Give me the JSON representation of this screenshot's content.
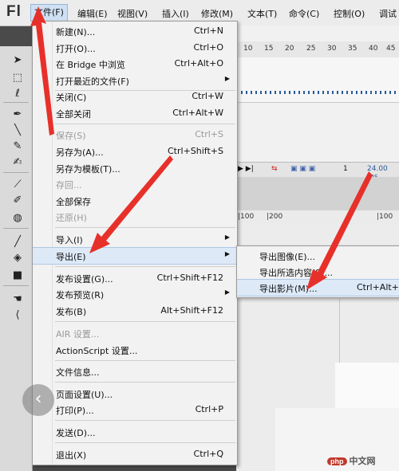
{
  "app": {
    "logo": "Fl"
  },
  "menubar": {
    "items": [
      "文件(F)",
      "编辑(E)",
      "视图(V)",
      "插入(I)",
      "修改(M)",
      "文本(T)",
      "命令(C)",
      "控制(O)",
      "调试"
    ],
    "active_index": 0
  },
  "file_menu": {
    "items": [
      {
        "label": "新建(N)...",
        "shortcut": "Ctrl+N",
        "enabled": true
      },
      {
        "label": "打开(O)...",
        "shortcut": "Ctrl+O",
        "enabled": true
      },
      {
        "label": "在 Bridge 中浏览",
        "shortcut": "Ctrl+Alt+O",
        "enabled": true
      },
      {
        "label": "打开最近的文件(F)",
        "shortcut": "",
        "enabled": true,
        "submenu": true
      },
      {
        "label": "关闭(C)",
        "shortcut": "Ctrl+W",
        "enabled": true
      },
      {
        "label": "全部关闭",
        "shortcut": "Ctrl+Alt+W",
        "enabled": true
      },
      {
        "label": "保存(S)",
        "shortcut": "Ctrl+S",
        "enabled": false
      },
      {
        "label": "另存为(A)...",
        "shortcut": "Ctrl+Shift+S",
        "enabled": true
      },
      {
        "label": "另存为模板(T)...",
        "shortcut": "",
        "enabled": true
      },
      {
        "label": "存回...",
        "shortcut": "",
        "enabled": false
      },
      {
        "label": "全部保存",
        "shortcut": "",
        "enabled": true
      },
      {
        "label": "还原(H)",
        "shortcut": "",
        "enabled": false
      },
      {
        "label": "导入(I)",
        "shortcut": "",
        "enabled": true,
        "submenu": true
      },
      {
        "label": "导出(E)",
        "shortcut": "",
        "enabled": true,
        "submenu": true,
        "highlight": true
      },
      {
        "label": "发布设置(G)...",
        "shortcut": "Ctrl+Shift+F12",
        "enabled": true
      },
      {
        "label": "发布预览(R)",
        "shortcut": "",
        "enabled": true,
        "submenu": true
      },
      {
        "label": "发布(B)",
        "shortcut": "Alt+Shift+F12",
        "enabled": true
      },
      {
        "label": "AIR 设置...",
        "shortcut": "",
        "enabled": false
      },
      {
        "label": "ActionScript 设置...",
        "shortcut": "",
        "enabled": true
      },
      {
        "label": "文件信息...",
        "shortcut": "",
        "enabled": true
      },
      {
        "label": "页面设置(U)...",
        "shortcut": "",
        "enabled": true
      },
      {
        "label": "打印(P)...",
        "shortcut": "Ctrl+P",
        "enabled": true
      },
      {
        "label": "发送(D)...",
        "shortcut": "",
        "enabled": true
      },
      {
        "label": "退出(X)",
        "shortcut": "Ctrl+Q",
        "enabled": true
      }
    ]
  },
  "export_submenu": {
    "items": [
      {
        "label": "导出图像(E)...",
        "shortcut": ""
      },
      {
        "label": "导出所选内容(S)...",
        "shortcut": ""
      },
      {
        "label": "导出影片(M)...",
        "shortcut": "Ctrl+Alt+S",
        "highlight": true
      }
    ]
  },
  "ruler_top": [
    "10",
    "15",
    "20",
    "25",
    "30",
    "35",
    "40",
    "45"
  ],
  "timeline": {
    "frame": "1",
    "fps": "24.00 fps"
  },
  "ruler_stage": [
    "|100",
    "|200",
    "|100"
  ],
  "watermark": {
    "badge": "php",
    "text": "中文网"
  },
  "colors": {
    "menu_bg": "#f2f2f2",
    "highlight": "#dde9f7",
    "arrow": "#e8302a",
    "toolbox": "#dadada"
  }
}
